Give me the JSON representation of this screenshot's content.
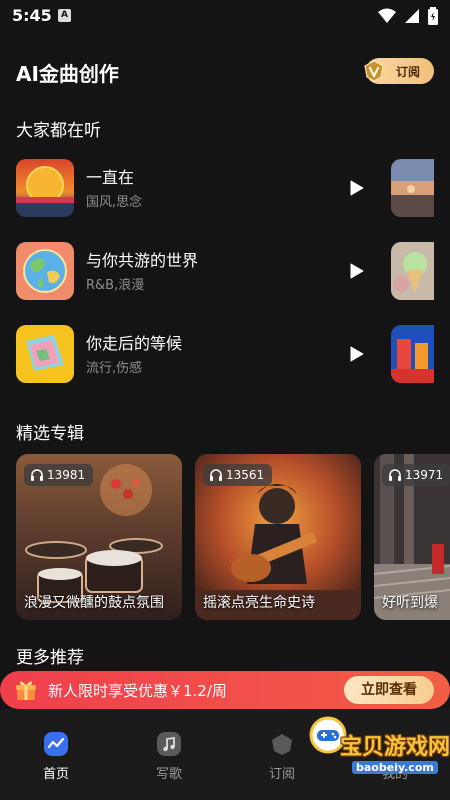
{
  "status": {
    "time": "5:45",
    "notification_glyph": "A"
  },
  "header": {
    "title": "AI金曲创作",
    "subscribe_label": "订阅"
  },
  "popular": {
    "title": "大家都在听",
    "songs": [
      {
        "name": "一直在",
        "tags": "国风,思念"
      },
      {
        "name": "与你共游的世界",
        "tags": "R&B,浪漫"
      },
      {
        "name": "你走后的等候",
        "tags": "流行,伤感"
      }
    ]
  },
  "albums": {
    "title": "精选专辑",
    "items": [
      {
        "plays": "13981",
        "title": "浪漫又微醺的鼓点氛围"
      },
      {
        "plays": "13561",
        "title": "摇滚点亮生命史诗"
      },
      {
        "plays": "13971",
        "title": "好听到爆"
      }
    ]
  },
  "more": {
    "title": "更多推荐"
  },
  "promo": {
    "text": "新人限时享受优惠￥1.2/周",
    "button": "立即查看"
  },
  "nav": {
    "items": [
      {
        "label": "首页",
        "icon": "home-wave-icon",
        "active": true
      },
      {
        "label": "写歌",
        "icon": "music-note-icon",
        "active": false
      },
      {
        "label": "订阅",
        "icon": "subscribe-icon",
        "active": false
      },
      {
        "label": "我的",
        "icon": "profile-icon",
        "active": false
      }
    ]
  },
  "watermark": {
    "title": "宝贝游戏网",
    "url": "baobeiy.com"
  },
  "colors": {
    "background": "#141414",
    "promo": "#ef3f4c",
    "gold": "#f7cd8e",
    "nav_bg": "#1b1b1b"
  }
}
